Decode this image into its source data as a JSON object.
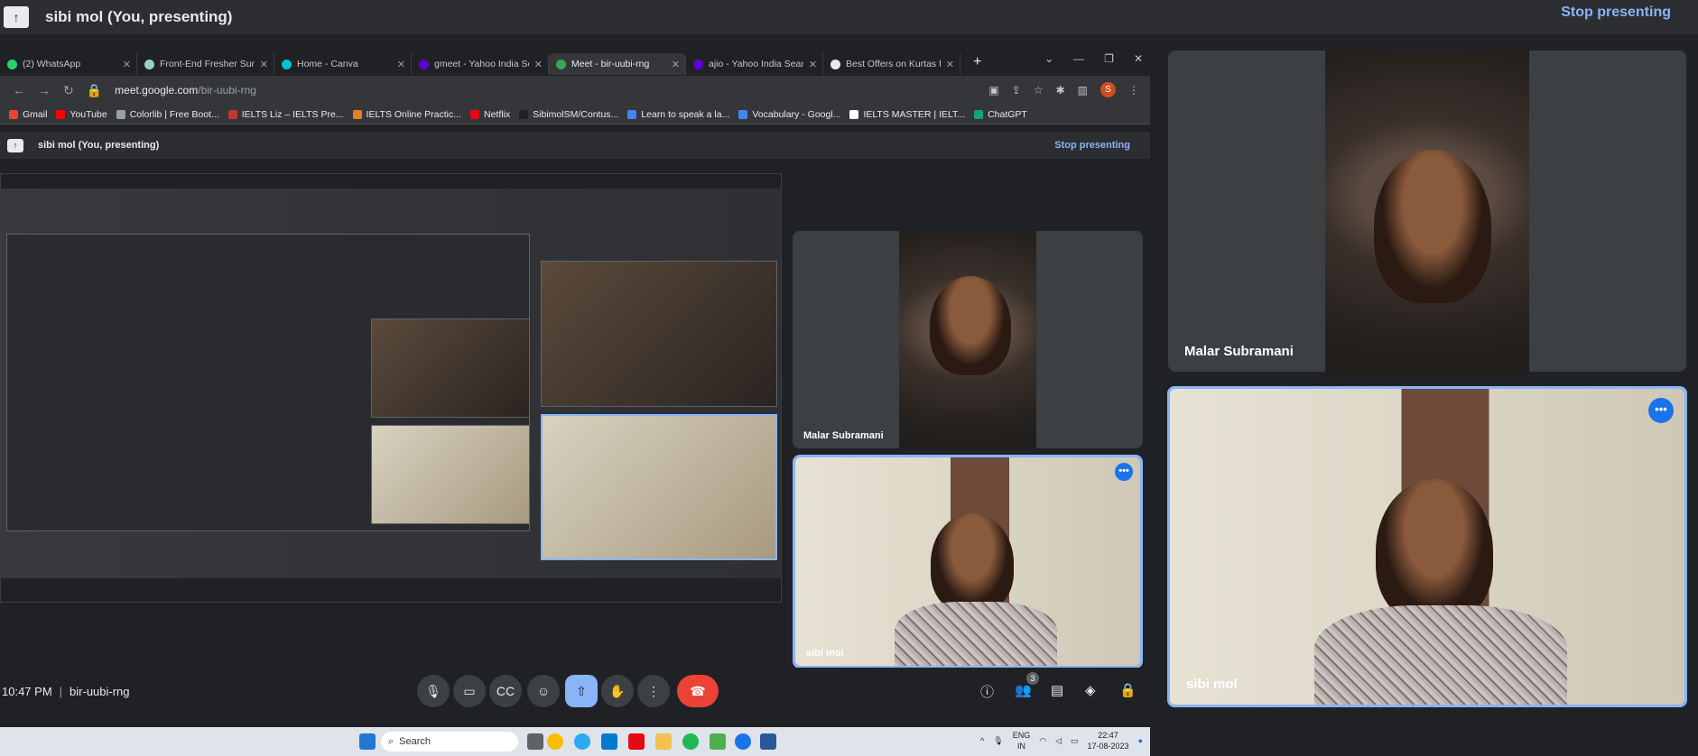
{
  "presenting_bar": {
    "title": "sibi mol (You, presenting)",
    "stop_label": "Stop presenting"
  },
  "browser": {
    "tabs": [
      {
        "label": "(2) WhatsApp",
        "color": "#25d366"
      },
      {
        "label": "Front-End Fresher Sum...",
        "color": "#9ccfc9"
      },
      {
        "label": "Home - Canva",
        "color": "#00c4cc"
      },
      {
        "label": "gmeet - Yahoo India Sea...",
        "color": "#6001d2"
      },
      {
        "label": "Meet - bir-uubi-rng",
        "color": "#34a853",
        "active": true
      },
      {
        "label": "ajio - Yahoo India Search",
        "color": "#6001d2"
      },
      {
        "label": "Best Offers on Kurtas for...",
        "color": "#e8eaed"
      }
    ],
    "url_host": "meet.google.com",
    "url_path": "/bir-uubi-rng",
    "profile_initial": "S",
    "bookmarks": [
      {
        "label": "Gmail",
        "color": "#ea4335"
      },
      {
        "label": "YouTube",
        "color": "#ff0000"
      },
      {
        "label": "Colorlib | Free Boot...",
        "color": "#9aa0a6"
      },
      {
        "label": "IELTS Liz – IELTS Pre...",
        "color": "#c0392b"
      },
      {
        "label": "IELTS Online Practic...",
        "color": "#e67e22"
      },
      {
        "label": "Netflix",
        "color": "#e50914"
      },
      {
        "label": "SibimolSM/Contus...",
        "color": "#202124"
      },
      {
        "label": "Learn to speak a la...",
        "color": "#4285f4"
      },
      {
        "label": "Vocabulary - Googl...",
        "color": "#4285f4"
      },
      {
        "label": "IELTS MASTER | IELT...",
        "color": "#ffffff"
      },
      {
        "label": "ChatGPT",
        "color": "#10a37f"
      }
    ]
  },
  "inner_meet": {
    "title": "sibi mol (You, presenting)",
    "stop_label": "Stop presenting",
    "tiles": [
      {
        "name": "Malar Subramani"
      },
      {
        "name": "sibi mol"
      }
    ]
  },
  "meet_controls": {
    "time": "10:47 PM",
    "meeting_code": "bir-uubi-rng",
    "participant_count": "3"
  },
  "taskbar": {
    "search_placeholder": "Search",
    "lang_line1": "ENG",
    "lang_line2": "IN",
    "time": "22:47",
    "date": "17-08-2023"
  },
  "participants": [
    {
      "name": "Malar Subramani"
    },
    {
      "name": "sibi mol"
    }
  ]
}
